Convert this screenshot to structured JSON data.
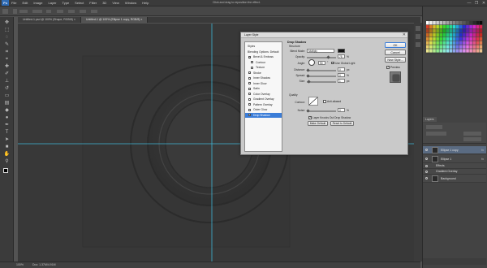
{
  "app": {
    "logo": "Ps",
    "menus": [
      "File",
      "Edit",
      "Image",
      "Layer",
      "Type",
      "Select",
      "Filter",
      "3D",
      "View",
      "Window",
      "Help"
    ],
    "hint": "Click and drag to reposition the effect.",
    "window_controls": [
      "—",
      "❐",
      "✕"
    ]
  },
  "tabs": [
    {
      "label": "Untitled-1.psd @ 100% (Shape, RGB/8) ×",
      "active": false
    },
    {
      "label": "Untitled-1 @ 100% (Ellipse 1 copy, RGB/8) ×",
      "active": true
    }
  ],
  "status": {
    "zoom": "100%",
    "doc": "Doc: 1.37M/4.91M"
  },
  "layers_panel": {
    "tab": "Layers",
    "layers": [
      {
        "name": "Ellipse 1 copy",
        "fx": "fx",
        "selected": true
      },
      {
        "name": "Ellipse 1",
        "fx": "fx",
        "selected": false
      },
      {
        "name": "Effects",
        "fx": "",
        "selected": false,
        "sub": true
      },
      {
        "name": "Gradient Overlay",
        "fx": "",
        "selected": false,
        "sub": true
      },
      {
        "name": "Background",
        "fx": "",
        "selected": false
      }
    ]
  },
  "dialog": {
    "title": "Layer Style",
    "close": "✕",
    "styles": [
      {
        "label": "Styles",
        "type": "head"
      },
      {
        "label": "Blending Options: Default",
        "type": "head"
      },
      {
        "label": "Bevel & Emboss",
        "checked": true
      },
      {
        "label": "Contour",
        "checked": false,
        "sub": true
      },
      {
        "label": "Texture",
        "checked": false,
        "sub": true
      },
      {
        "label": "Stroke",
        "checked": false
      },
      {
        "label": "Inner Shadow",
        "checked": false
      },
      {
        "label": "Inner Glow",
        "checked": false
      },
      {
        "label": "Satin",
        "checked": false
      },
      {
        "label": "Color Overlay",
        "checked": false
      },
      {
        "label": "Gradient Overlay",
        "checked": false
      },
      {
        "label": "Pattern Overlay",
        "checked": false
      },
      {
        "label": "Outer Glow",
        "checked": false
      },
      {
        "label": "Drop Shadow",
        "checked": true,
        "selected": true
      }
    ],
    "drop_shadow": {
      "title": "Drop Shadow",
      "structure": "Structure",
      "blend_mode_label": "Blend Mode:",
      "blend_mode": "Multiply",
      "opacity_label": "Opacity:",
      "opacity": "75",
      "angle_label": "Angle:",
      "angle": "90",
      "global_light": "Use Global Light",
      "distance_label": "Distance:",
      "distance": "0",
      "spread_label": "Spread:",
      "spread": "0",
      "size_label": "Size:",
      "size": "1",
      "unit_pct": "%",
      "unit_px": "px",
      "unit_deg": "°",
      "quality": "Quality",
      "contour_label": "Contour:",
      "anti_aliased": "Anti-aliased",
      "noise_label": "Noise:",
      "noise": "0",
      "knockout": "Layer Knocks Out Drop Shadow",
      "make_default": "Make Default",
      "reset_default": "Reset to Default"
    },
    "buttons": {
      "ok": "OK",
      "cancel": "Cancel",
      "new_style": "New Style...",
      "preview": "Preview"
    }
  },
  "colors": {
    "canvas": "#3a3a3a",
    "guide": "#3fb6d6",
    "selection": "#3b7dd8"
  }
}
